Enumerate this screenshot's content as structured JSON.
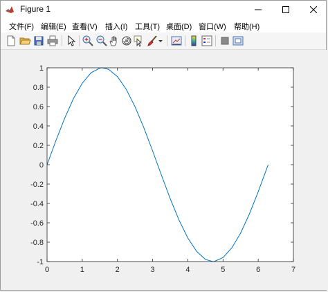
{
  "window": {
    "title": "Figure 1"
  },
  "menu": {
    "items": [
      {
        "label": "文件(F)"
      },
      {
        "label": "编辑(E)"
      },
      {
        "label": "查看(V)"
      },
      {
        "label": "插入(I)"
      },
      {
        "label": "工具(T)"
      },
      {
        "label": "桌面(D)"
      },
      {
        "label": "窗口(W)"
      },
      {
        "label": "帮助(H)"
      }
    ]
  },
  "toolbar": {
    "buttons": [
      "new-figure-icon",
      "open-file-icon",
      "save-icon",
      "print-icon",
      "pointer-icon",
      "zoom-in-icon",
      "zoom-out-icon",
      "pan-hand-icon",
      "rotate-3d-icon",
      "data-cursor-icon",
      "brush-icon",
      "brush-dropdown-icon",
      "link-plot-icon",
      "colorbar-icon",
      "legend-icon",
      "hide-plot-tools-icon",
      "show-plot-tools-icon"
    ]
  },
  "chart_data": {
    "type": "line",
    "function": "y = sin(x)",
    "x": [
      0,
      0.25,
      0.5,
      0.75,
      1,
      1.25,
      1.5,
      1.5708,
      1.75,
      2,
      2.25,
      2.5,
      2.75,
      3,
      3.25,
      3.5,
      3.75,
      4,
      4.25,
      4.5,
      4.7124,
      4.75,
      5,
      5.25,
      5.5,
      5.75,
      6,
      6.2832
    ],
    "y": [
      0,
      0.247,
      0.479,
      0.682,
      0.841,
      0.949,
      0.997,
      1,
      0.984,
      0.909,
      0.778,
      0.598,
      0.382,
      0.141,
      -0.108,
      -0.351,
      -0.572,
      -0.757,
      -0.895,
      -0.978,
      -1,
      -0.999,
      -0.959,
      -0.859,
      -0.706,
      -0.508,
      -0.279,
      0
    ],
    "xlim": [
      0,
      7
    ],
    "ylim": [
      -1,
      1
    ],
    "xticks": [
      "0",
      "1",
      "2",
      "3",
      "4",
      "5",
      "6",
      "7"
    ],
    "yticks": [
      "-1",
      "-0.8",
      "-0.6",
      "-0.4",
      "-0.2",
      "0",
      "0.2",
      "0.4",
      "0.6",
      "0.8",
      "1"
    ],
    "line_color": "#0072BD",
    "grid": false
  }
}
